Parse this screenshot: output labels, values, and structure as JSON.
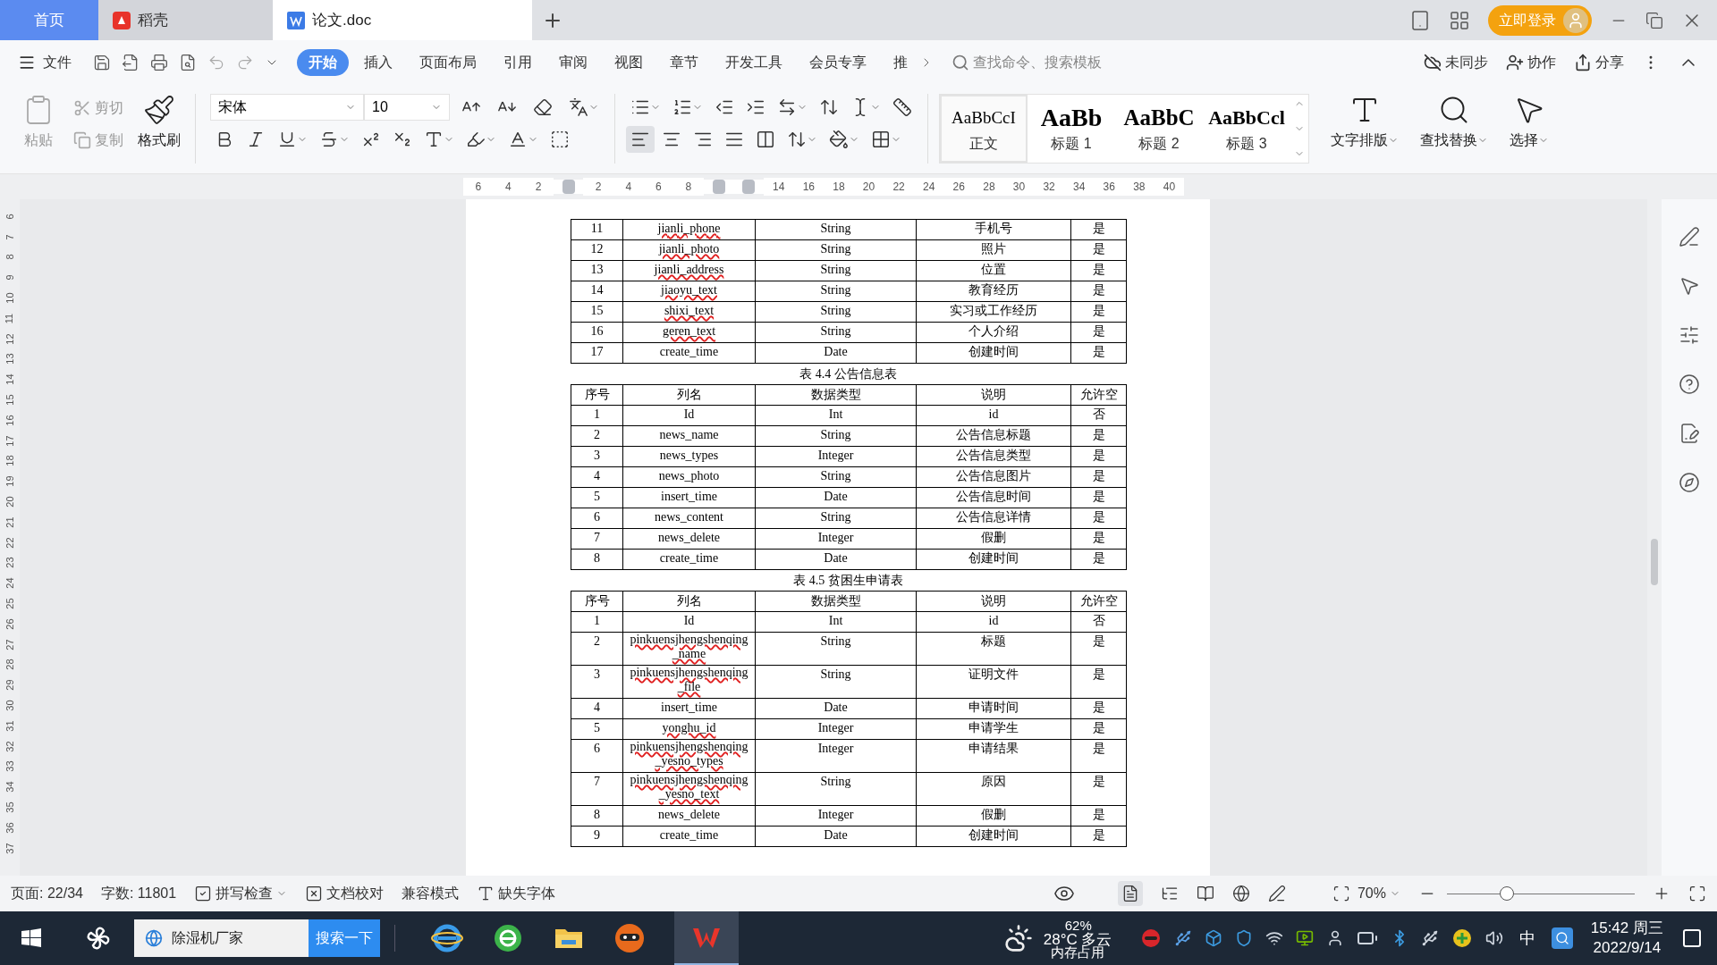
{
  "tabs": [
    {
      "label": "首页",
      "kind": "home",
      "selected": false
    },
    {
      "label": "稻壳",
      "kind": "app",
      "selected": false
    },
    {
      "label": "论文.doc",
      "kind": "doc",
      "selected": true
    }
  ],
  "login": "立即登录",
  "menu": {
    "file": "文件",
    "tabs": [
      {
        "label": "开始",
        "selected": true
      },
      {
        "label": "插入",
        "selected": false
      },
      {
        "label": "页面布局",
        "selected": false
      },
      {
        "label": "引用",
        "selected": false
      },
      {
        "label": "审阅",
        "selected": false
      },
      {
        "label": "视图",
        "selected": false
      },
      {
        "label": "章节",
        "selected": false
      },
      {
        "label": "开发工具",
        "selected": false
      },
      {
        "label": "会员专享",
        "selected": false
      },
      {
        "label": "推",
        "selected": false
      }
    ],
    "search_placeholder": "查找命令、搜索模板",
    "actions": [
      "未同步",
      "协作",
      "分享"
    ]
  },
  "clipboard": [
    {
      "label": "粘贴",
      "disabled": true
    },
    {
      "label": "剪切",
      "disabled": true
    },
    {
      "label": "复制",
      "disabled": true
    },
    {
      "label": "格式刷",
      "disabled": false
    }
  ],
  "font": {
    "name": "宋体",
    "size": "10"
  },
  "alignment": [
    {
      "selected": true
    },
    {
      "selected": false
    },
    {
      "selected": false
    },
    {
      "selected": false
    },
    {
      "selected": false
    }
  ],
  "styles": [
    {
      "preview": "AaBbCcI",
      "label": "正文",
      "kind": "body",
      "selected": true
    },
    {
      "preview": "AaBb",
      "label": "标题 1",
      "kind": "h1",
      "selected": false
    },
    {
      "preview": "AaBbC",
      "label": "标题 2",
      "kind": "h2",
      "selected": false
    },
    {
      "preview": "AaBbCcl",
      "label": "标题 3",
      "kind": "h3",
      "selected": false
    }
  ],
  "tools": [
    "文字排版",
    "查找替换",
    "选择"
  ],
  "ruler": [
    {
      "kind": "number",
      "label": "6"
    },
    {
      "kind": "number",
      "label": "4"
    },
    {
      "kind": "number",
      "label": "2"
    },
    {
      "kind": "marker"
    },
    {
      "kind": "number",
      "label": "2"
    },
    {
      "kind": "number",
      "label": "4"
    },
    {
      "kind": "number",
      "label": "6"
    },
    {
      "kind": "number",
      "label": "8"
    },
    {
      "kind": "marker"
    },
    {
      "kind": "marker"
    },
    {
      "kind": "number",
      "label": "14"
    },
    {
      "kind": "number",
      "label": "16"
    },
    {
      "kind": "number",
      "label": "18"
    },
    {
      "kind": "number",
      "label": "20"
    },
    {
      "kind": "number",
      "label": "22"
    },
    {
      "kind": "number",
      "label": "24"
    },
    {
      "kind": "number",
      "label": "26"
    },
    {
      "kind": "number",
      "label": "28"
    },
    {
      "kind": "number",
      "label": "30"
    },
    {
      "kind": "number",
      "label": "32"
    },
    {
      "kind": "number",
      "label": "34"
    },
    {
      "kind": "number",
      "label": "36"
    },
    {
      "kind": "number",
      "label": "38"
    },
    {
      "kind": "number",
      "label": "40"
    }
  ],
  "vertical_ruler": [
    "6",
    "7",
    "8",
    "9",
    "10",
    "11",
    "12",
    "13",
    "14",
    "15",
    "16",
    "17",
    "18",
    "19",
    "20",
    "21",
    "22",
    "23",
    "24",
    "25",
    "26",
    "27",
    "28",
    "29",
    "30",
    "31",
    "32",
    "33",
    "34",
    "35",
    "36",
    "37"
  ],
  "document": [
    {
      "kind": "table",
      "rows": [
        {
          "cells": [
            "11",
            "jianli_phone",
            "String",
            "手机号",
            "是"
          ],
          "flagged": true
        },
        {
          "cells": [
            "12",
            "jianli_photo",
            "String",
            "照片",
            "是"
          ],
          "flagged": true
        },
        {
          "cells": [
            "13",
            "jianli_address",
            "String",
            "位置",
            "是"
          ],
          "flagged": true
        },
        {
          "cells": [
            "14",
            "jiaoyu_text",
            "String",
            "教育经历",
            "是"
          ],
          "flagged": true
        },
        {
          "cells": [
            "15",
            "shixi_text",
            "String",
            "实习或工作经历",
            "是"
          ],
          "flagged": true
        },
        {
          "cells": [
            "16",
            "geren_text",
            "String",
            "个人介绍",
            "是"
          ],
          "flagged": true
        },
        {
          "cells": [
            "17",
            "create_time",
            "Date",
            "创建时间",
            "是"
          ],
          "flagged": false
        }
      ]
    },
    {
      "kind": "caption",
      "text": "表 4.4 公告信息表"
    },
    {
      "kind": "table",
      "header": [
        "序号",
        "列名",
        "数据类型",
        "说明",
        "允许空"
      ],
      "rows": [
        {
          "cells": [
            "1",
            "Id",
            "Int",
            "id",
            "否"
          ],
          "flagged": false
        },
        {
          "cells": [
            "2",
            "news_name",
            "String",
            "公告信息标题",
            "是"
          ],
          "flagged": false
        },
        {
          "cells": [
            "3",
            "news_types",
            "Integer",
            "公告信息类型",
            "是"
          ],
          "flagged": false
        },
        {
          "cells": [
            "4",
            "news_photo",
            "String",
            "公告信息图片",
            "是"
          ],
          "flagged": false
        },
        {
          "cells": [
            "5",
            "insert_time",
            "Date",
            "公告信息时间",
            "是"
          ],
          "flagged": false
        },
        {
          "cells": [
            "6",
            "news_content",
            "String",
            "公告信息详情",
            "是"
          ],
          "flagged": false
        },
        {
          "cells": [
            "7",
            "news_delete",
            "Integer",
            "假删",
            "是"
          ],
          "flagged": false
        },
        {
          "cells": [
            "8",
            "create_time",
            "Date",
            "创建时间",
            "是"
          ],
          "flagged": false
        }
      ]
    },
    {
      "kind": "caption",
      "text": "表 4.5 贫困生申请表"
    },
    {
      "kind": "table",
      "header": [
        "序号",
        "列名",
        "数据类型",
        "说明",
        "允许空"
      ],
      "rows": [
        {
          "cells": [
            "1",
            "Id",
            "Int",
            "id",
            "否"
          ],
          "flagged": false
        },
        {
          "cells": [
            "2",
            "pinkuensjhengshenqing_name",
            "String",
            "标题",
            "是"
          ],
          "flagged": true
        },
        {
          "cells": [
            "3",
            "pinkuensjhengshenqing_file",
            "String",
            "证明文件",
            "是"
          ],
          "flagged": true
        },
        {
          "cells": [
            "4",
            "insert_time",
            "Date",
            "申请时间",
            "是"
          ],
          "flagged": false
        },
        {
          "cells": [
            "5",
            "yonghu_id",
            "Integer",
            "申请学生",
            "是"
          ],
          "flagged": true
        },
        {
          "cells": [
            "6",
            "pinkuensjhengshenqing_yesno_types",
            "Integer",
            "申请结果",
            "是"
          ],
          "flagged": true
        },
        {
          "cells": [
            "7",
            "pinkuensjhengshenqing_yesno_text",
            "String",
            "原因",
            "是"
          ],
          "flagged": true
        },
        {
          "cells": [
            "8",
            "news_delete",
            "Integer",
            "假删",
            "是"
          ],
          "flagged": false
        },
        {
          "cells": [
            "9",
            "create_time",
            "Date",
            "创建时间",
            "是"
          ],
          "flagged": false
        }
      ]
    }
  ],
  "status": {
    "page": "页面: 22/34",
    "words": "字数: 11801",
    "items": [
      "拼写检查",
      "文档校对",
      "兼容模式",
      "缺失字体"
    ],
    "zoom": "70%",
    "zoom_slider": {
      "level": 0.32
    }
  },
  "taskbar": {
    "search": {
      "value": "除湿机厂家",
      "button": "搜索一下"
    },
    "weather": {
      "temp": "28°C",
      "desc": "多云"
    },
    "memory": {
      "percent": "62%",
      "label": "内存占用"
    },
    "ime": "中",
    "time": "15:42 周三",
    "date": "2022/9/14"
  }
}
